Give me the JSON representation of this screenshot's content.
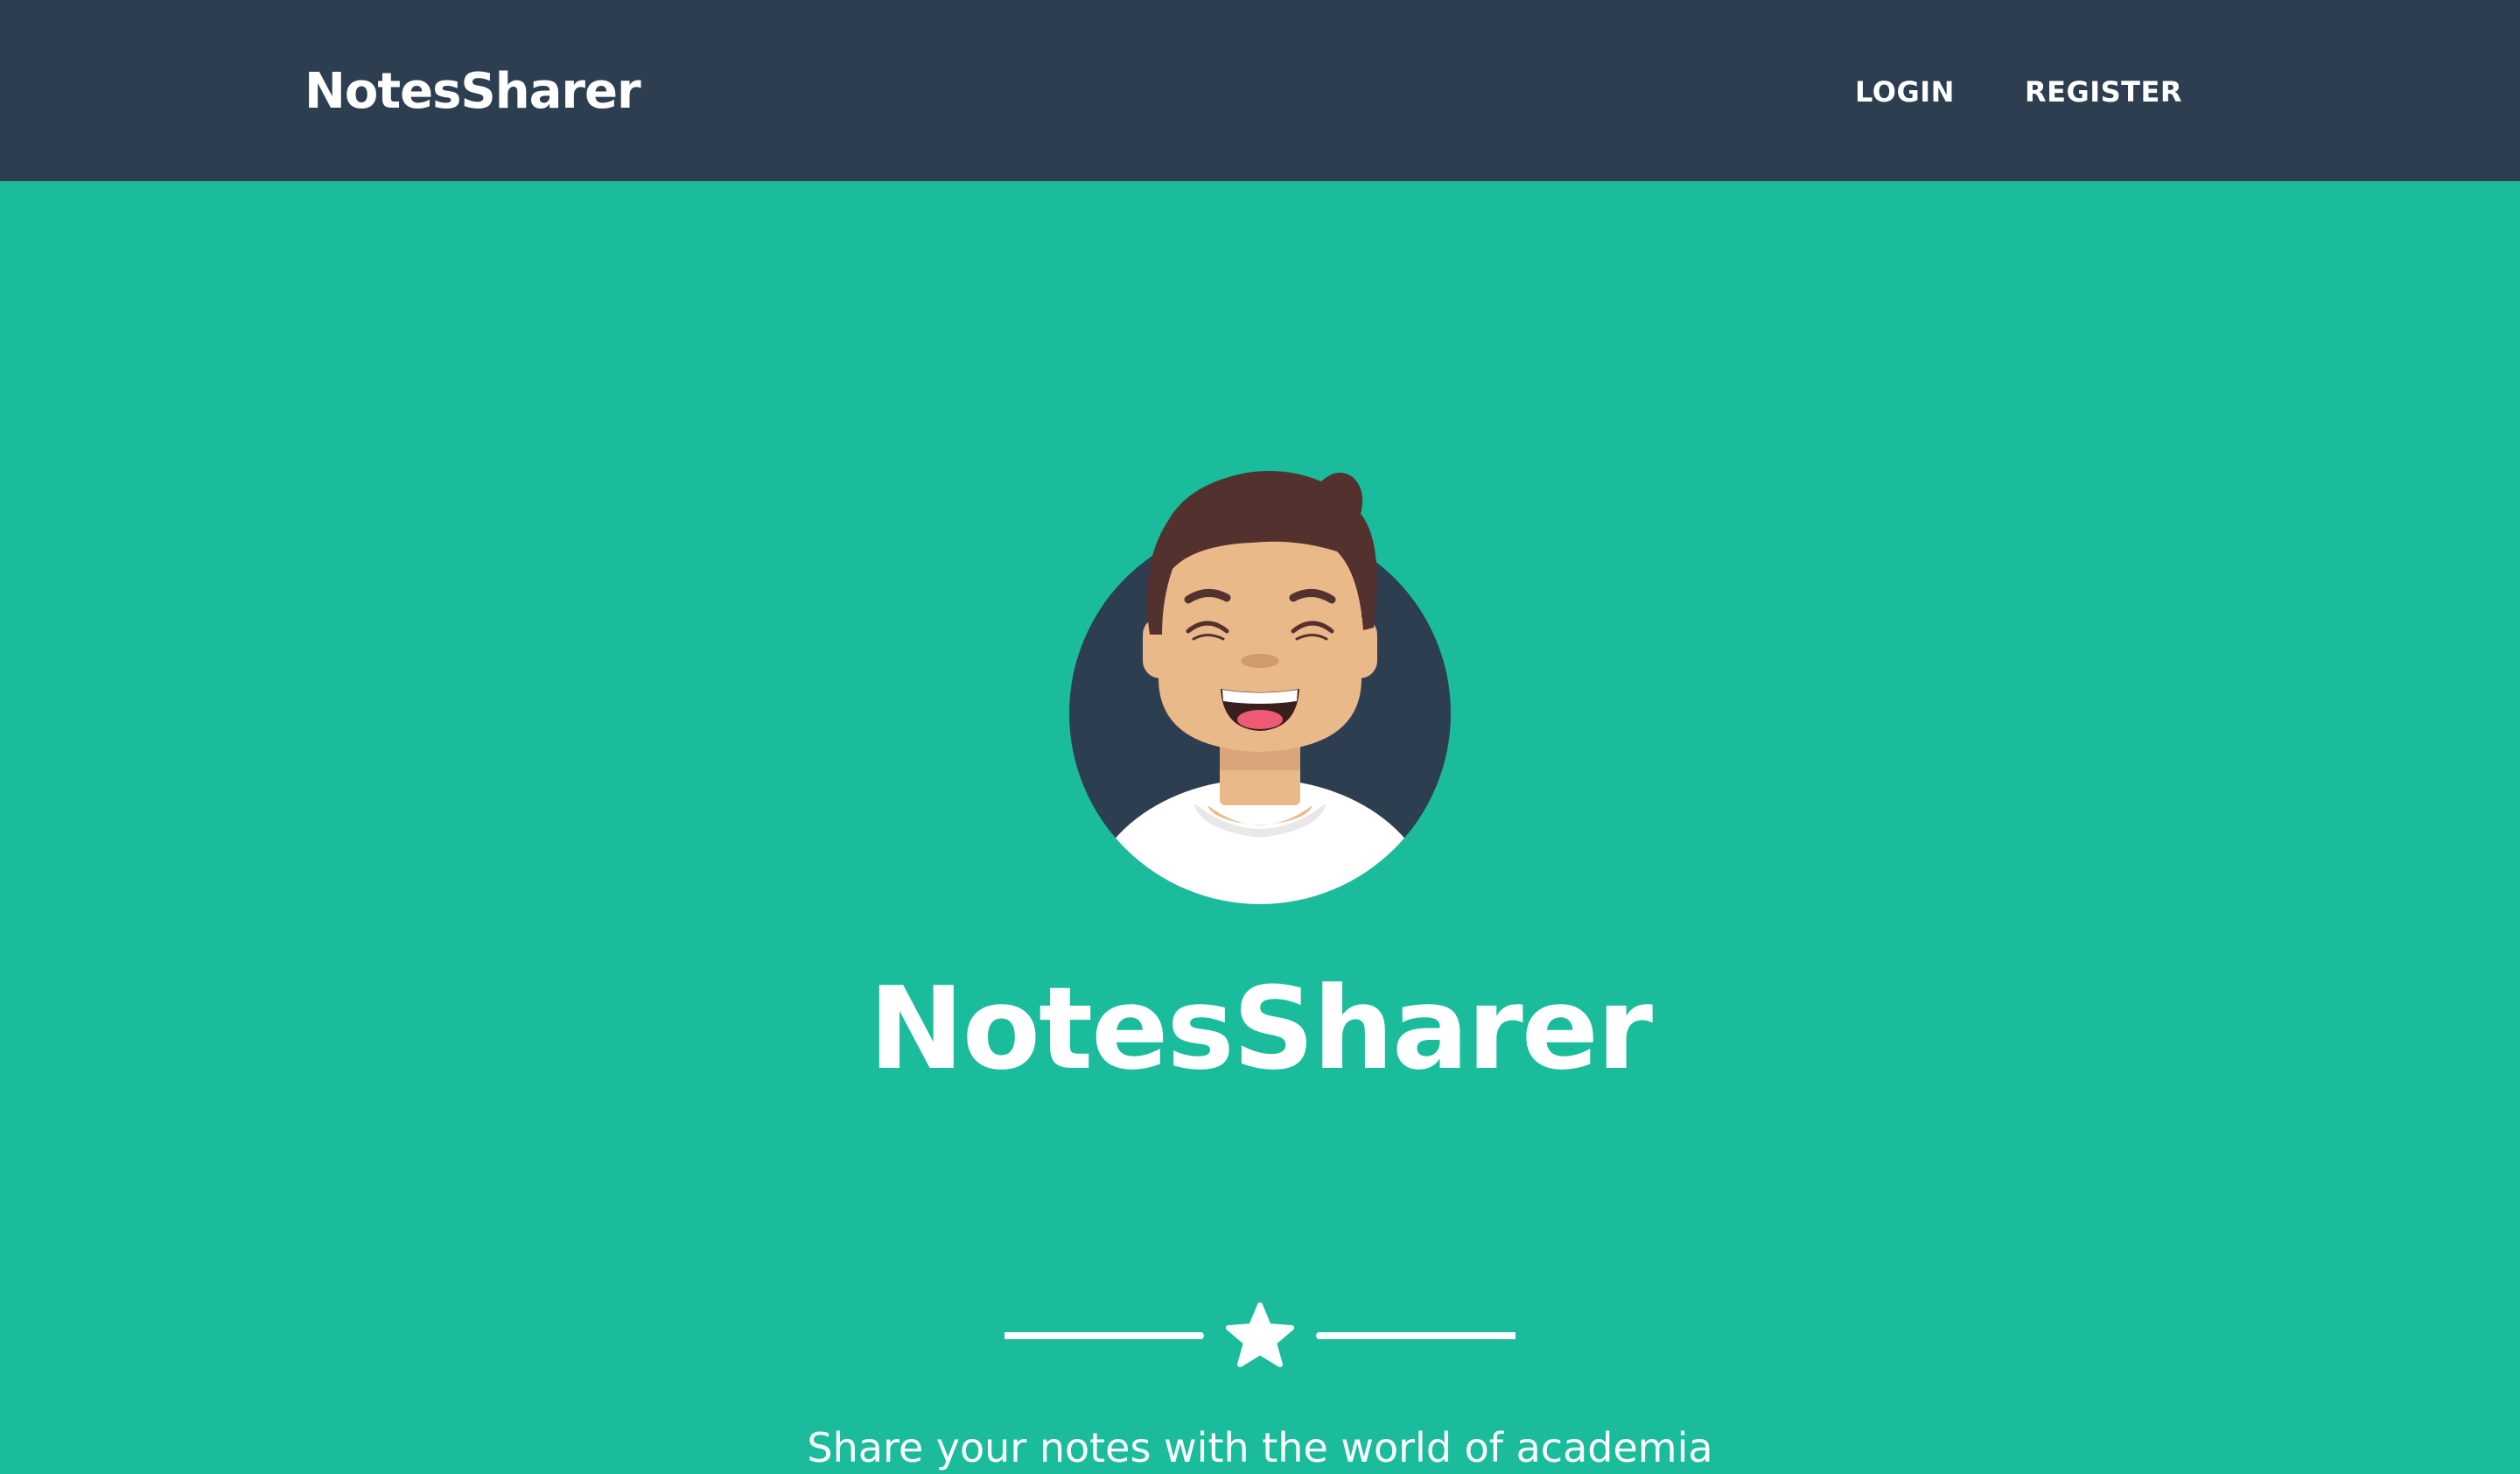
{
  "navbar": {
    "brand": "NotesSharer",
    "links": [
      {
        "label": "LOGIN"
      },
      {
        "label": "REGISTER"
      }
    ]
  },
  "masthead": {
    "avatar": "smiling-person-avatar",
    "title": "NotesSharer",
    "divider_icon": "star-icon",
    "tagline": "Share your notes with the world of academia"
  },
  "colors": {
    "navbar_bg": "#2c3e50",
    "page_bg": "#1abc9c",
    "text": "#ffffff",
    "avatar_circle": "#2c3e50",
    "skin": "#eab98a",
    "hair": "#53312e"
  }
}
